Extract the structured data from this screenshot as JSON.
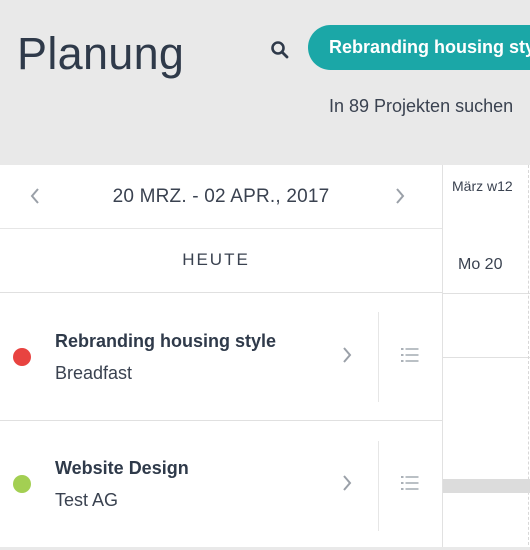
{
  "header": {
    "title": "Planung",
    "search_chip": "Rebranding housing style",
    "search_hint": "In 89 Projekten suchen"
  },
  "date_nav": {
    "range": "20 MRZ. - 02 APR., 2017",
    "today_label": "HEUTE"
  },
  "projects": [
    {
      "name": "Rebranding housing style",
      "client": "Breadfast",
      "color": "#e84340"
    },
    {
      "name": "Website Design",
      "client": "Test AG",
      "color": "#a3cf52"
    }
  ],
  "calendar": {
    "week_label": "März w12",
    "day_label": "Mo 20"
  },
  "colors": {
    "accent": "#1ba7a7",
    "header_bg": "#e9e9e9"
  },
  "icons": [
    "search-icon",
    "chevron-left-icon",
    "chevron-right-icon",
    "list-icon"
  ]
}
